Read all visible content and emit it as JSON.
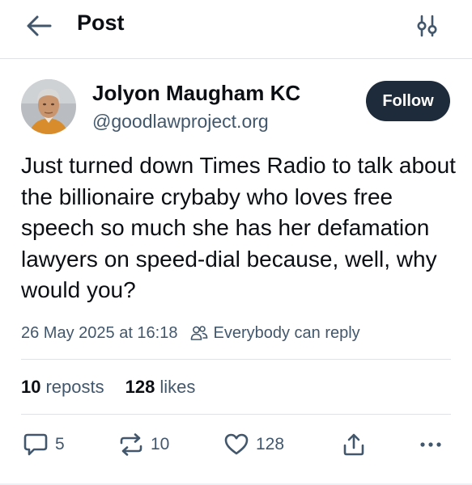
{
  "header": {
    "title": "Post",
    "back_icon": "arrow-left-icon",
    "settings_icon": "sliders-icon"
  },
  "author": {
    "name": "Jolyon Maugham KC",
    "handle": "@goodlawproject.org",
    "follow_label": "Follow"
  },
  "post": {
    "text": "Just turned down Times Radio to talk about the billionaire crybaby who loves free speech so much she has her defamation lawyers on speed-dial because, well, why would you?",
    "timestamp": "26 May 2025 at 16:18",
    "reply_setting": "Everybody can reply"
  },
  "stats": {
    "reposts_count": "10",
    "reposts_label": "reposts",
    "likes_count": "128",
    "likes_label": "likes"
  },
  "actions": {
    "reply_count": "5",
    "repost_count": "10",
    "like_count": "128"
  },
  "colors": {
    "text": "#0b0f14",
    "muted": "#42576c",
    "follow_bg": "#1e2b3a",
    "divider": "#dfe3e8"
  }
}
